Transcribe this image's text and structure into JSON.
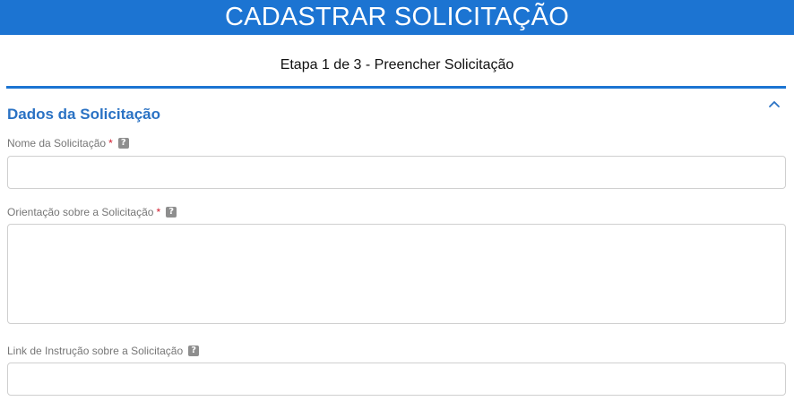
{
  "header": {
    "title": "CADASTRAR SOLICITAÇÃO"
  },
  "step": {
    "text": "Etapa 1 de 3 - Preencher Solicitação"
  },
  "section": {
    "title": "Dados da Solicitação",
    "collapse_icon": "chevron-up-icon"
  },
  "fields": {
    "nome": {
      "label": "Nome da Solicitação",
      "required_mark": "*",
      "help": "?",
      "value": ""
    },
    "orientacao": {
      "label": "Orientação sobre a Solicitação",
      "required_mark": "*",
      "help": "?",
      "value": ""
    },
    "link": {
      "label": "Link de Instrução sobre a Solicitação",
      "help": "?",
      "value": ""
    }
  },
  "colors": {
    "brand": "#1c74d2",
    "section_title": "#2a72c4",
    "required": "#d0192b"
  }
}
